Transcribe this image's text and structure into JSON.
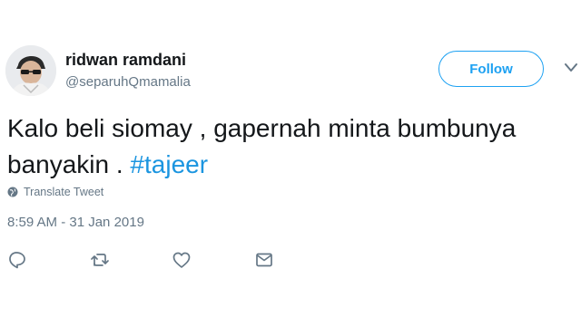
{
  "tweet": {
    "display_name": "ridwan ramdani",
    "handle": "@separuhQmamalia",
    "text_main": "Kalo beli siomay , gapernah minta bumbunya banyakin . ",
    "hashtag": "#tajeer",
    "translate_label": "Translate Tweet",
    "timestamp": "8:59 AM - 31 Jan 2019"
  },
  "header": {
    "follow_label": "Follow"
  },
  "icons": {
    "avatar": "avatar",
    "caret": "chevron-down-icon",
    "translate": "globe-icon",
    "reply": "reply-icon",
    "retweet": "retweet-icon",
    "like": "heart-icon",
    "dm": "envelope-icon"
  },
  "colors": {
    "accent": "#1da1f2",
    "hashtag": "#1b95e0",
    "secondary_text": "#657786"
  }
}
